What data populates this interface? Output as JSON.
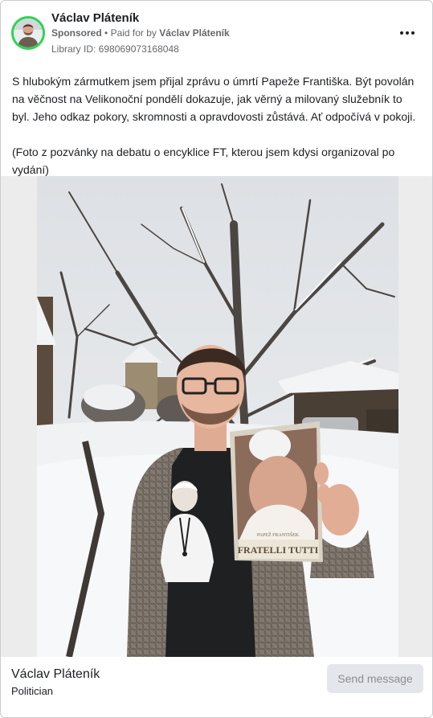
{
  "ad": {
    "page_name": "Václav Pláteník",
    "sponsored_label": "Sponsored",
    "paid_for_by_prefix": "Paid for by",
    "paid_for_by_name": "Václav Pláteník",
    "library_id": "Library ID: 698069073168048",
    "more_options_icon": "more-horizontal-icon",
    "avatar_ring_color": "#2fd34f"
  },
  "post": {
    "paragraph_1": "S hlubokým zármutkem jsem přijal zprávu o úmrtí Papeže Františka. Být povolán na věčnost na Velikonoční pondělí dokazuje, jak věrný a milovaný služebník to byl. Jeho odkaz pokory, skromnosti a opravdovosti zůstává. Ať odpočívá v pokoji.",
    "paragraph_2": "(Foto z pozvánky na debatu o encyklice FT, kterou jsem kdysi organizoval po vydání)"
  },
  "photo": {
    "book_title": "FRATELLI TUTTI",
    "book_author": "PAPEŽ FRANTIŠEK"
  },
  "footer": {
    "name": "Václav Pláteník",
    "category": "Politician",
    "send_message_label": "Send message"
  }
}
